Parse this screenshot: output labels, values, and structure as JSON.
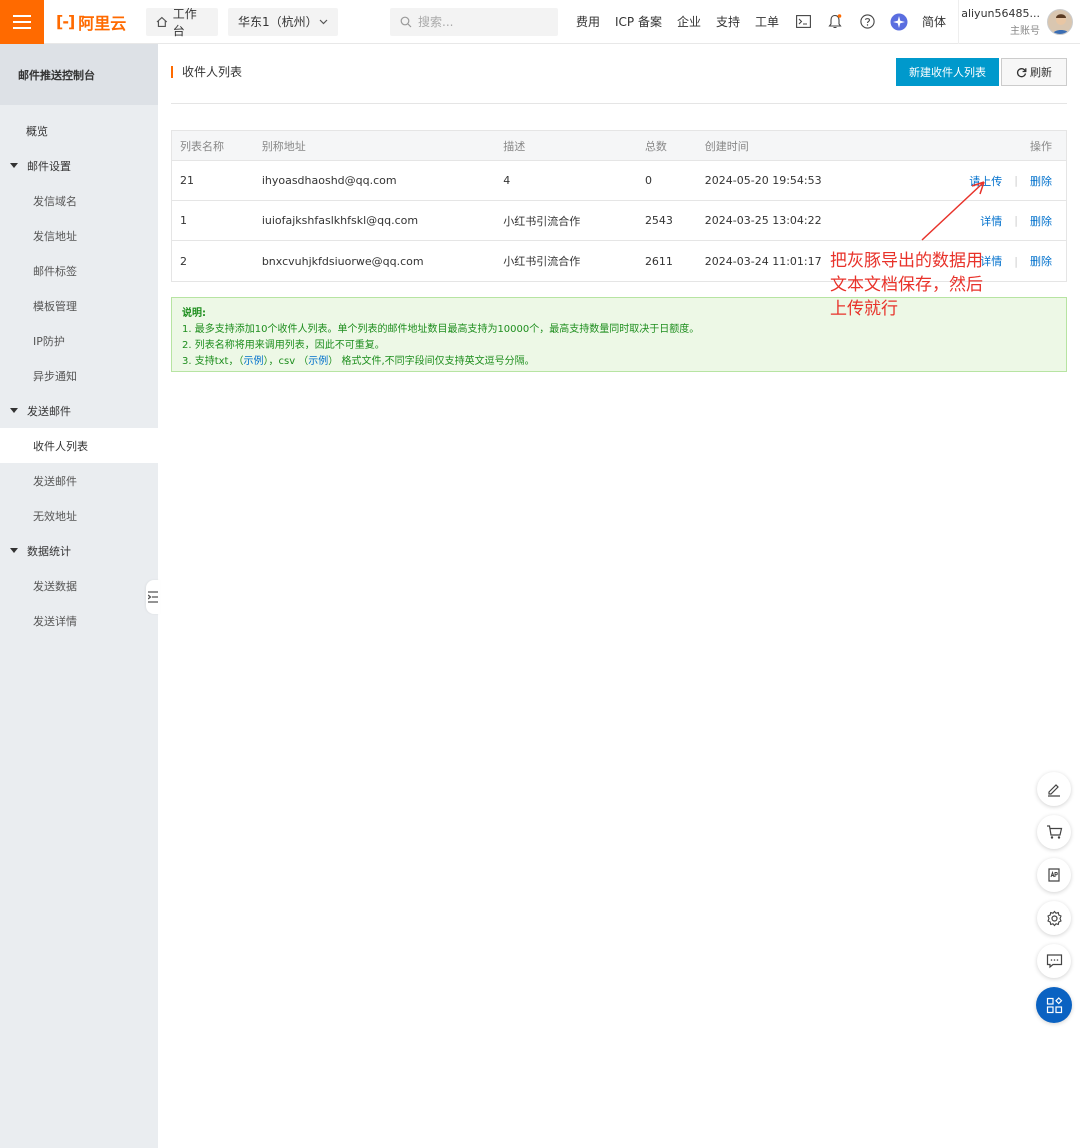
{
  "header": {
    "logo_text": "阿里云",
    "workbench": "工作台",
    "region": "华东1（杭州）",
    "search_placeholder": "搜索...",
    "nav": [
      "费用",
      "ICP 备案",
      "企业",
      "支持",
      "工单"
    ],
    "lang": "简体",
    "user_name": "aliyun56485...",
    "user_role": "主账号"
  },
  "sidebar": {
    "title": "邮件推送控制台",
    "overview": "概览",
    "groups": [
      {
        "label": "邮件设置",
        "items": [
          "发信域名",
          "发信地址",
          "邮件标签",
          "模板管理",
          "IP防护",
          "异步通知"
        ]
      },
      {
        "label": "发送邮件",
        "items": [
          "收件人列表",
          "发送邮件",
          "无效地址"
        ]
      },
      {
        "label": "数据统计",
        "items": [
          "发送数据",
          "发送详情"
        ]
      }
    ],
    "active": "收件人列表"
  },
  "main": {
    "title": "收件人列表",
    "new_button": "新建收件人列表",
    "refresh_button": "刷新",
    "table": {
      "headers": [
        "列表名称",
        "别称地址",
        "描述",
        "总数",
        "创建时间",
        "操作"
      ],
      "rows": [
        {
          "name": "21",
          "alias": "ihyoasdhaoshd@qq.com",
          "desc": "4",
          "total": "0",
          "created": "2024-05-20 19:54:53",
          "action1": "请上传",
          "action2": "删除"
        },
        {
          "name": "1",
          "alias": "iuiofajkshfaslkhfskl@qq.com",
          "desc": "小红书引流合作",
          "total": "2543",
          "created": "2024-03-25 13:04:22",
          "action1": "详情",
          "action2": "删除"
        },
        {
          "name": "2",
          "alias": "bnxcvuhjkfdsiuorwe@qq.com",
          "desc": "小红书引流合作",
          "total": "2611",
          "created": "2024-03-24 11:01:17",
          "action1": "详情",
          "action2": "删除"
        }
      ]
    },
    "notice": {
      "title": "说明:",
      "line1": "1. 最多支持添加10个收件人列表。单个列表的邮件地址数目最高支持为10000个，最高支持数量同时取决于日额度。",
      "line2": "2. 列表名称将用来调用列表，因此不可重复。",
      "line3_a": "3. 支持txt，（",
      "line3_link1": "示例",
      "line3_b": "），csv （",
      "line3_link2": "示例",
      "line3_c": "） 格式文件,不同字段间仅支持英文逗号分隔。"
    }
  },
  "annotation": {
    "line1": "把灰豚导出的数据用",
    "line2": "文本文档保存，然后",
    "line3": "上传就行",
    "color": "#e8322a"
  },
  "colors": {
    "brand": "#ff6a00",
    "primary": "#0099cc",
    "link": "#0070cc"
  }
}
